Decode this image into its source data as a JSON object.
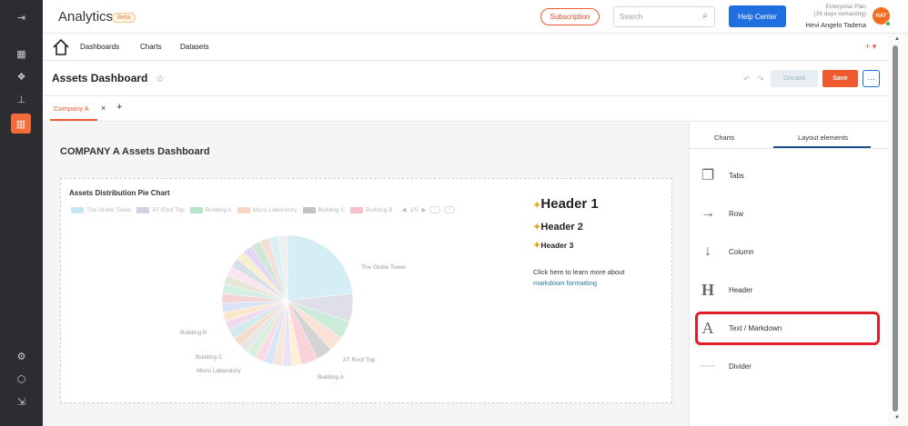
{
  "rail": {
    "items": [
      {
        "name": "collapse-sidebar-icon",
        "glyph": "⇥"
      },
      {
        "name": "dashboard-grid-icon",
        "glyph": "▦"
      },
      {
        "name": "datasets-icon",
        "glyph": "❖"
      },
      {
        "name": "hierarchy-icon",
        "glyph": "⊥"
      },
      {
        "name": "charts-icon",
        "glyph": "▥"
      },
      {
        "name": "settings-icon",
        "glyph": "⚙"
      },
      {
        "name": "box-icon",
        "glyph": "⬡"
      },
      {
        "name": "logout-icon",
        "glyph": "⇲"
      }
    ]
  },
  "header": {
    "brand": "Analytics",
    "beta": "Beta",
    "subscription": "Subscription",
    "search_placeholder": "Search",
    "help": "Help Center",
    "plan_line1": "Enterprise Plan",
    "plan_line2": "(26 days remaining)",
    "user_name": "Hevi Angelo Tadena",
    "avatar_initials": "HAT"
  },
  "nav": {
    "links": [
      "Dashboards",
      "Charts",
      "Datasets"
    ],
    "plus_menu": "+ ▾"
  },
  "titlebar": {
    "title": "Assets Dashboard",
    "undo": "↶",
    "redo": "↷",
    "discard": "Discard",
    "save": "Save",
    "more": "···"
  },
  "tabs": {
    "active": "Company A",
    "close": "×",
    "add": "+"
  },
  "canvas": {
    "title": "COMPANY A Assets Dashboard"
  },
  "chart_data": {
    "type": "pie",
    "title": "Assets Distribution Pie Chart",
    "legend": {
      "placement": "top",
      "entries": [
        "The Globe Tower",
        "AT Roof Top",
        "Building A",
        "Micro Laboratory",
        "Building C",
        "Building B"
      ],
      "page": "1/5"
    },
    "labels": [
      "The Globe Tower",
      "AT Roof Top",
      "Building A",
      "Micro Laboratory",
      "Building C",
      "Building B"
    ],
    "series": [
      {
        "values": [
          25,
          7.5,
          4.8,
          4.2,
          4.2,
          4.5,
          2.5,
          2.5,
          2.5,
          2.5,
          2.5,
          2.5,
          2.5,
          2.5,
          2.5,
          2.5,
          2.5,
          2.5,
          2.5,
          2.5,
          2.5,
          2.5,
          2.5,
          2.5,
          2.5,
          2.5,
          2.5,
          2.5,
          2.5
        ]
      }
    ],
    "colors": [
      "#56b8d6",
      "#7f7fa8",
      "#36b06b",
      "#f58a5a",
      "#555555",
      "#e84a6a",
      "#f2c94c",
      "#b38ae0",
      "#e0a060",
      "#5ea0e0",
      "#f07090",
      "#6cc070",
      "#a0a0a0",
      "#e07040",
      "#40b0b0",
      "#c070c0",
      "#f0a030",
      "#7090e0",
      "#d05050",
      "#50c090",
      "#a0a060",
      "#f090c0",
      "#6080a0",
      "#e0c040",
      "#9060d0",
      "#40a060",
      "#d08060",
      "#70c0e0",
      "#c0c0c0"
    ],
    "legend_colors": [
      "#56b8d6",
      "#7f7fa8",
      "#36b06b",
      "#f58a5a",
      "#555555",
      "#e84a6a"
    ],
    "faded": true
  },
  "markdown": {
    "h1": "Header 1",
    "h2": "Header 2",
    "h3": "Header 3",
    "p1": "Click here to learn more about",
    "link": "markdown formatting"
  },
  "panel": {
    "tab_charts": "Charts",
    "tab_layout": "Layout elements",
    "elements": [
      {
        "name": "tabs",
        "label": "Tabs",
        "glyph": "❐"
      },
      {
        "name": "row",
        "label": "Row",
        "glyph": "→"
      },
      {
        "name": "column",
        "label": "Column",
        "glyph": "↓"
      },
      {
        "name": "header",
        "label": "Header",
        "glyph": "H"
      },
      {
        "name": "text-markdown",
        "label": "Text / Markdown",
        "glyph": "A"
      },
      {
        "name": "divider",
        "label": "Divider",
        "glyph": "—"
      }
    ]
  }
}
